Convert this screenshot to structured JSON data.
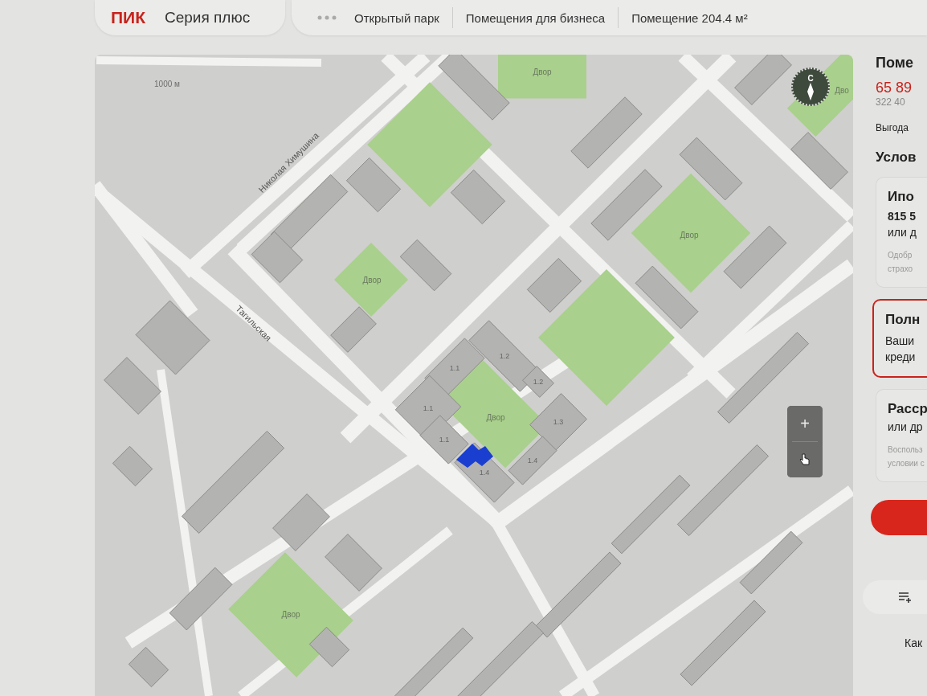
{
  "header": {
    "logo": "ПИК",
    "project": "Серия плюс",
    "breadcrumbs": [
      "Открытый парк",
      "Помещения для бизнеса",
      "Помещение 204.4 м²"
    ]
  },
  "map": {
    "scale": "1000 м",
    "compass": "С",
    "zoom_in": "+",
    "labels": [
      {
        "kind": "street",
        "text": "Николая Химушина"
      },
      {
        "kind": "street",
        "text": "Тагильская"
      },
      {
        "kind": "yard",
        "text": "Двор"
      },
      {
        "kind": "yard",
        "text": "Дво"
      },
      {
        "kind": "yard",
        "text": "Двор"
      },
      {
        "kind": "yard",
        "text": "Двор"
      },
      {
        "kind": "yard",
        "text": "Двор"
      },
      {
        "kind": "yard",
        "text": "Двор"
      },
      {
        "kind": "building",
        "text": "1.2"
      },
      {
        "kind": "building",
        "text": "1.1"
      },
      {
        "kind": "building",
        "text": "1.2"
      },
      {
        "kind": "building",
        "text": "1.1"
      },
      {
        "kind": "building",
        "text": "1.3"
      },
      {
        "kind": "building",
        "text": "1.1"
      },
      {
        "kind": "building",
        "text": "1.4"
      },
      {
        "kind": "building",
        "text": "1.4"
      }
    ]
  },
  "panel": {
    "title": "Поме",
    "price": "65 89",
    "price_per_meter": "322 40",
    "benefit": "Выгода",
    "conditions": "Услов",
    "cards": [
      {
        "selected": false,
        "title": "Ипо",
        "amount": "815 5",
        "subtitle": "или д",
        "note": [
          "Одобр",
          "страхо"
        ]
      },
      {
        "selected": true,
        "title": "Полн",
        "lines": [
          "Ваши",
          "креди"
        ]
      },
      {
        "selected": false,
        "title": "Расср",
        "subtitle": "или др",
        "note": [
          "Воспольз",
          "условии с"
        ]
      }
    ],
    "footer_link": "Как"
  }
}
